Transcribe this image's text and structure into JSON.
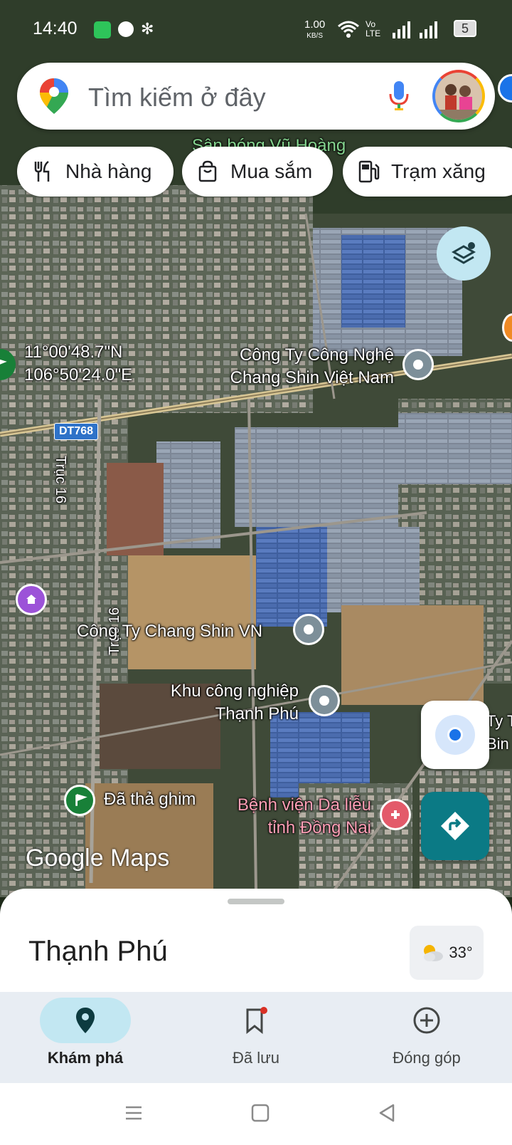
{
  "status_bar": {
    "time": "14:40",
    "net_speed": "1.00",
    "net_unit": "KB/S",
    "carrier": "Vo LTE",
    "battery": "5"
  },
  "search": {
    "placeholder": "Tìm kiếm ở đây"
  },
  "chips": [
    {
      "label": "Nhà hàng",
      "icon": "restaurant-icon"
    },
    {
      "label": "Mua sắm",
      "icon": "shopping-bag-icon"
    },
    {
      "label": "Trạm xăng",
      "icon": "gas-station-icon"
    }
  ],
  "map": {
    "coordinate_lat": "11°00'48.7\"N",
    "coordinate_lng": "106°50'24.0\"E",
    "road_sign": "DT768",
    "road_labels": [
      "Trục 16",
      "Trục 16"
    ],
    "places": [
      {
        "name_line1": "Công Ty Công Nghệ",
        "name_line2": "Chang Shin Việt Nam"
      },
      {
        "name_line1": "Công Ty Chang Shin VN"
      },
      {
        "name_line1": "Khu công nghiệp",
        "name_line2": "Thạnh Phú"
      },
      {
        "name_line1": "Đã thả ghim"
      },
      {
        "name_line1": "Bệnh viện Da liễu",
        "name_line2": "tỉnh Đồng Nai"
      },
      {
        "name_line1": "Sân bóng Vũ Hoàng"
      }
    ],
    "partial_right_labels": [
      "Ty T",
      "Bin"
    ],
    "logo": "Google Maps"
  },
  "sheet": {
    "title": "Thạnh Phú",
    "temperature": "33°"
  },
  "bottom_nav": [
    {
      "label": "Khám phá",
      "icon": "explore-pin-icon",
      "active": true
    },
    {
      "label": "Đã lưu",
      "icon": "bookmark-icon",
      "active": false
    },
    {
      "label": "Đóng góp",
      "icon": "add-circle-icon",
      "active": false
    }
  ],
  "colors": {
    "accent": "#0b7a85",
    "active_pill": "#c2e7f2",
    "nav_bg": "#e8edf3"
  }
}
